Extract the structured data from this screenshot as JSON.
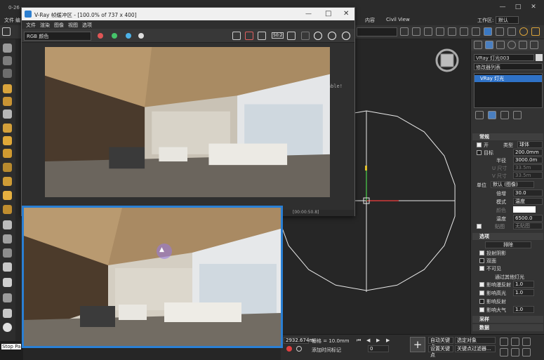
{
  "max_window": {
    "title": "0-26",
    "menu": [
      "文件",
      "编"
    ],
    "menu_right": [
      "内容",
      "Civil View"
    ],
    "workspace_label": "工作区:",
    "workspace_value": "默认"
  },
  "left_status": {
    "text": "Stop Pa"
  },
  "vfb": {
    "title": "V-Ray 帧缓冲区 - [100.0% of 737 x 400]",
    "menu": [
      "文件",
      "渲染",
      "图像",
      "视图",
      "选项"
    ],
    "channel_value": "RGB 颜色",
    "update_notice": "V-Ray update available!",
    "status_text": "[00:00:50.8]",
    "compare_label": "50:2"
  },
  "command_panel": {
    "object_name": "VRay 灯光003",
    "modifier_list": "修改器列表",
    "stack_item": "VRay 灯光",
    "rollout_general": "常规",
    "on_label": "开",
    "on_checked": true,
    "type_label": "类型",
    "type_value": "球体",
    "type_size": "200.0mm",
    "target_label": "目标",
    "target_checked": false,
    "radius_label": "半径",
    "radius_value": "3000.0m",
    "usize_label": "U 尺寸",
    "usize_value": "33.5m",
    "vsize_label": "V 尺寸",
    "vsize_value": "33.5m",
    "units_label": "单位",
    "units_value": "默认 (图像)",
    "multiplier_label": "倍增",
    "multiplier_value": "30.0",
    "mode_label": "模式",
    "mode_value": "温度",
    "color_label": "颜色",
    "temp_label": "温度",
    "temp_value": "6500.0",
    "texture_label": "贴图",
    "texture_value": "无贴图",
    "rollout_options": "选项",
    "exclude_label": "排除",
    "cast_shadows_label": "投射阴影",
    "cast_shadows_checked": true,
    "double_sided_label": "双面",
    "double_sided_checked": false,
    "invisible_label": "不可见",
    "invisible_checked": true,
    "affect_others_label": "通过其他灯光",
    "affect_diffuse_label": "影响漫反射",
    "affect_diffuse_value": "1.0",
    "affect_specular_label": "影响高光",
    "affect_specular_value": "1.0",
    "affect_reflections_label": "影响反射",
    "affect_atmo_label": "影响大气",
    "affect_atmo_value": "1.0",
    "rollout_sampling": "采样",
    "rollout_viewport": "数据"
  },
  "bottom_bar": {
    "coord_value": "2932.674m",
    "grid_label": "栅格 = 10.0mm",
    "auto_key_label": "自动关键点",
    "set_key_label": "设置关键点",
    "selected_label": "选定对象",
    "key_filter_label": "关键点过滤器...",
    "add_time_tag": "添加时间标记",
    "frame_value": "0"
  },
  "colors": {
    "accent_blue": "#2a7fd4",
    "dot_red": "#e05555",
    "dot_green": "#46c46a",
    "dot_blue": "#4db2e8",
    "viewport_circle": "#e8e8e8"
  }
}
